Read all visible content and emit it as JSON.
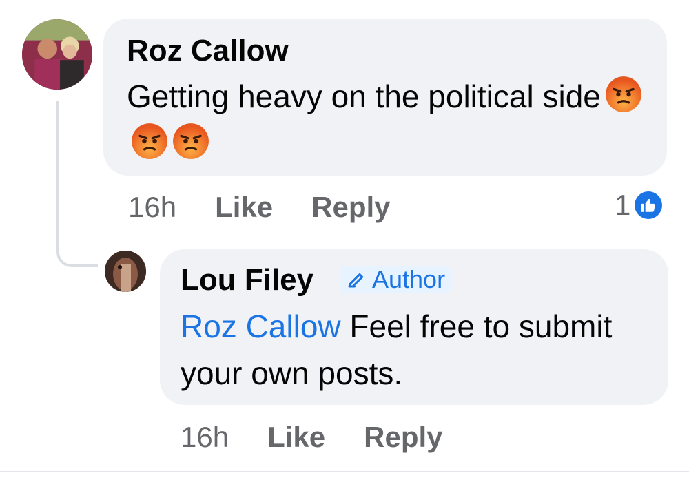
{
  "comment": {
    "author": "Roz Callow",
    "text": "Getting heavy on the political side",
    "emojis": [
      "angry-emoji",
      "angry-emoji",
      "angry-emoji"
    ],
    "time": "16h",
    "like_label": "Like",
    "reply_label": "Reply",
    "reaction_count": "1",
    "reaction_icon": "thumbs-up-icon"
  },
  "reply": {
    "author": "Lou Filey",
    "badge_label": "Author",
    "badge_icon": "pencil-icon",
    "mention": "Roz Callow",
    "text": " Feel free to submit your own posts.",
    "time": "16h",
    "like_label": "Like",
    "reply_label": "Reply"
  },
  "colors": {
    "bubble": "#f0f2f5",
    "link": "#1b74e4",
    "secondary_text": "#65676b",
    "primary_text": "#050505"
  }
}
